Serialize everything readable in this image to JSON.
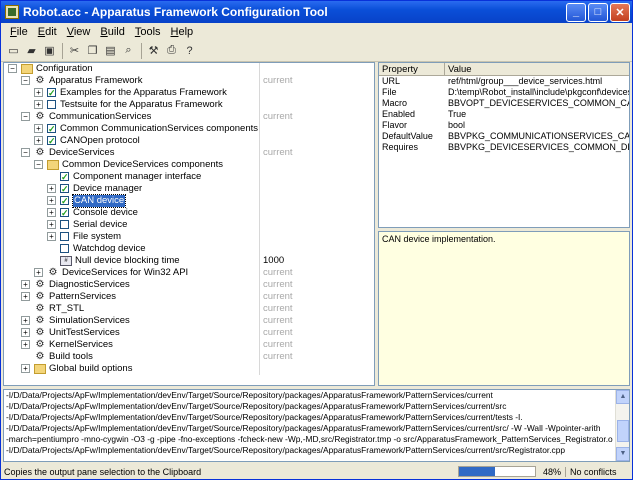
{
  "window": {
    "title": "Robot.acc - Apparatus Framework Configuration Tool"
  },
  "menu": [
    {
      "label": "File",
      "accel": "F"
    },
    {
      "label": "Edit",
      "accel": "E"
    },
    {
      "label": "View",
      "accel": "V"
    },
    {
      "label": "Build",
      "accel": "B"
    },
    {
      "label": "Tools",
      "accel": "T"
    },
    {
      "label": "Help",
      "accel": "H"
    }
  ],
  "toolbar": {
    "buttons": [
      "new-icon",
      "open-icon",
      "save-icon",
      "cut-icon",
      "copy-icon",
      "paste-icon",
      "find-icon",
      "build-icon",
      "print-icon",
      "help-icon"
    ]
  },
  "tree": [
    {
      "label": "Configuration",
      "depth": 0,
      "expander": "−",
      "icon": "folder",
      "checkbox": null,
      "value": ""
    },
    {
      "label": "Apparatus Framework",
      "depth": 1,
      "expander": "−",
      "icon": "component",
      "checkbox": null,
      "value": "current"
    },
    {
      "label": "Examples for the Apparatus Framework",
      "depth": 2,
      "expander": "+",
      "icon": null,
      "checkbox": true,
      "value": ""
    },
    {
      "label": "Testsuite for the Apparatus Framework",
      "depth": 2,
      "expander": "+",
      "icon": null,
      "checkbox": false,
      "value": ""
    },
    {
      "label": "CommunicationServices",
      "depth": 1,
      "expander": "−",
      "icon": "component",
      "checkbox": null,
      "value": "current"
    },
    {
      "label": "Common CommunicationServices components",
      "depth": 2,
      "expander": "+",
      "icon": null,
      "checkbox": true,
      "value": ""
    },
    {
      "label": "CANOpen protocol",
      "depth": 2,
      "expander": "+",
      "icon": null,
      "checkbox": true,
      "value": ""
    },
    {
      "label": "DeviceServices",
      "depth": 1,
      "expander": "−",
      "icon": "component",
      "checkbox": null,
      "value": "current"
    },
    {
      "label": "Common DeviceServices components",
      "depth": 2,
      "expander": "−",
      "icon": "folder",
      "checkbox": null,
      "value": ""
    },
    {
      "label": "Component manager interface",
      "depth": 3,
      "expander": null,
      "icon": null,
      "checkbox": true,
      "value": ""
    },
    {
      "label": "Device manager",
      "depth": 3,
      "expander": "+",
      "icon": null,
      "checkbox": true,
      "value": ""
    },
    {
      "label": "CAN device",
      "depth": 3,
      "expander": "+",
      "icon": null,
      "checkbox": true,
      "value": "",
      "selected": true
    },
    {
      "label": "Console device",
      "depth": 3,
      "expander": "+",
      "icon": null,
      "checkbox": true,
      "value": ""
    },
    {
      "label": "Serial device",
      "depth": 3,
      "expander": "+",
      "icon": null,
      "checkbox": false,
      "value": ""
    },
    {
      "label": "File system",
      "depth": 3,
      "expander": "+",
      "icon": null,
      "checkbox": false,
      "value": ""
    },
    {
      "label": "Watchdog device",
      "depth": 3,
      "expander": null,
      "icon": null,
      "checkbox": false,
      "value": ""
    },
    {
      "label": "Null device blocking time",
      "depth": 3,
      "expander": null,
      "icon": "number",
      "checkbox": null,
      "value": "1000",
      "valueDark": true
    },
    {
      "label": "DeviceServices for Win32 API",
      "depth": 2,
      "expander": "+",
      "icon": "component",
      "checkbox": null,
      "value": "current"
    },
    {
      "label": "DiagnosticServices",
      "depth": 1,
      "expander": "+",
      "icon": "component",
      "checkbox": null,
      "value": "current"
    },
    {
      "label": "PatternServices",
      "depth": 1,
      "expander": "+",
      "icon": "component",
      "checkbox": null,
      "value": "current"
    },
    {
      "label": "RT_STL",
      "depth": 1,
      "expander": null,
      "icon": "component",
      "checkbox": null,
      "value": "current"
    },
    {
      "label": "SimulationServices",
      "depth": 1,
      "expander": "+",
      "icon": "component",
      "checkbox": null,
      "value": "current"
    },
    {
      "label": "UnitTestServices",
      "depth": 1,
      "expander": "+",
      "icon": "component",
      "checkbox": null,
      "value": "current"
    },
    {
      "label": "KernelServices",
      "depth": 1,
      "expander": "+",
      "icon": "component",
      "checkbox": null,
      "value": "current"
    },
    {
      "label": "Build tools",
      "depth": 1,
      "expander": null,
      "icon": "component",
      "checkbox": null,
      "value": "current"
    },
    {
      "label": "Global build options",
      "depth": 1,
      "expander": "+",
      "icon": "folder",
      "checkbox": null,
      "value": ""
    }
  ],
  "properties": {
    "header_property": "Property",
    "header_value": "Value",
    "rows": [
      {
        "k": "URL",
        "v": "ref/html/group___device_services.html"
      },
      {
        "k": "File",
        "v": "D:\\temp\\Robot_install\\include\\pkgconf\\devices..."
      },
      {
        "k": "Macro",
        "v": "BBVOPT_DEVICESERVICES_COMMON_CANDEV..."
      },
      {
        "k": "Enabled",
        "v": "True"
      },
      {
        "k": "Flavor",
        "v": "bool"
      },
      {
        "k": "DefaultValue",
        "v": "BBVPKG_COMMUNICATIONSERVICES_CANOPEN"
      },
      {
        "k": "Requires",
        "v": "BBVPKG_DEVICESERVICES_COMMON_DEVICE..."
      }
    ]
  },
  "description": "CAN device implementation.",
  "output": [
    "-I/D/Data/Projects/ApFw/Implementation/devEnv/Target/Source/Repository/packages/ApparatusFramework/PatternServices/current",
    "-I/D/Data/Projects/ApFw/Implementation/devEnv/Target/Source/Repository/packages/ApparatusFramework/PatternServices/current/src",
    "-I/D/Data/Projects/ApFw/Implementation/devEnv/Target/Source/Repository/packages/ApparatusFramework/PatternServices/current/tests -I.",
    "-I/D/Data/Projects/ApFw/Implementation/devEnv/Target/Source/Repository/packages/ApparatusFramework/PatternServices/current/src/ -W -Wall -Wpointer-arith",
    "-march=pentiumpro -mno-cygwin -O3 -g -pipe -fno-exceptions -fcheck-new -Wp,-MD,src/Registrator.tmp -o src/ApparatusFramework_PatternServices_Registrator.o",
    "-I/D/Data/Projects/ApFw/Implementation/devEnv/Target/Source/Repository/packages/ApparatusFramework/PatternServices/current/src/Registrator.cpp"
  ],
  "status": {
    "text": "Copies the output pane selection to the Clipboard",
    "progress": 48,
    "progress_label": "48%",
    "conflicts": "No conflicts"
  }
}
